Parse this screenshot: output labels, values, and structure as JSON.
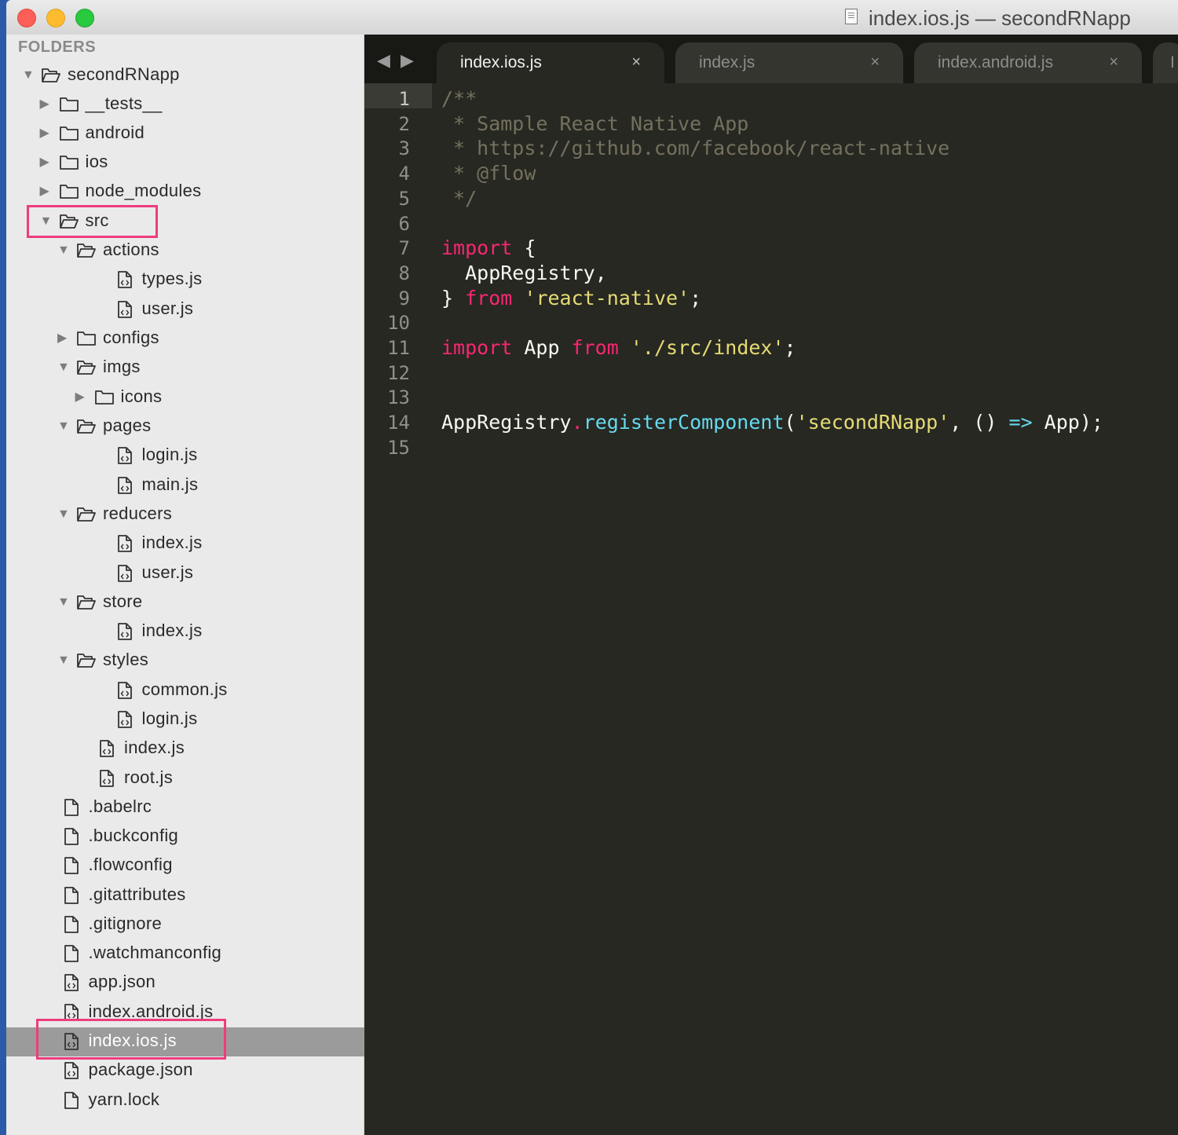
{
  "window": {
    "title": "index.ios.js — secondRNapp"
  },
  "sidebar": {
    "header": "FOLDERS",
    "tree": [
      {
        "label": "secondRNapp",
        "type": "folder",
        "open": true,
        "depth": 0
      },
      {
        "label": "__tests__",
        "type": "folder",
        "open": false,
        "depth": 1
      },
      {
        "label": "android",
        "type": "folder",
        "open": false,
        "depth": 1
      },
      {
        "label": "ios",
        "type": "folder",
        "open": false,
        "depth": 1
      },
      {
        "label": "node_modules",
        "type": "folder",
        "open": false,
        "depth": 1
      },
      {
        "label": "src",
        "type": "folder",
        "open": true,
        "depth": 1,
        "highlighted": true
      },
      {
        "label": "actions",
        "type": "folder",
        "open": true,
        "depth": 2
      },
      {
        "label": "types.js",
        "type": "js",
        "depth": 3
      },
      {
        "label": "user.js",
        "type": "js",
        "depth": 3
      },
      {
        "label": "configs",
        "type": "folder",
        "open": false,
        "depth": 2
      },
      {
        "label": "imgs",
        "type": "folder",
        "open": true,
        "depth": 2
      },
      {
        "label": "icons",
        "type": "folder",
        "open": false,
        "depth": 3
      },
      {
        "label": "pages",
        "type": "folder",
        "open": true,
        "depth": 2
      },
      {
        "label": "login.js",
        "type": "js",
        "depth": 3
      },
      {
        "label": "main.js",
        "type": "js",
        "depth": 3
      },
      {
        "label": "reducers",
        "type": "folder",
        "open": true,
        "depth": 2
      },
      {
        "label": "index.js",
        "type": "js",
        "depth": 3
      },
      {
        "label": "user.js",
        "type": "js",
        "depth": 3
      },
      {
        "label": "store",
        "type": "folder",
        "open": true,
        "depth": 2
      },
      {
        "label": "index.js",
        "type": "js",
        "depth": 3
      },
      {
        "label": "styles",
        "type": "folder",
        "open": true,
        "depth": 2
      },
      {
        "label": "common.js",
        "type": "js",
        "depth": 3
      },
      {
        "label": "login.js",
        "type": "js",
        "depth": 3
      },
      {
        "label": "index.js",
        "type": "js",
        "depth": 2
      },
      {
        "label": "root.js",
        "type": "js",
        "depth": 2
      },
      {
        "label": ".babelrc",
        "type": "file",
        "depth": 1
      },
      {
        "label": ".buckconfig",
        "type": "file",
        "depth": 1
      },
      {
        "label": ".flowconfig",
        "type": "file",
        "depth": 1
      },
      {
        "label": ".gitattributes",
        "type": "file",
        "depth": 1
      },
      {
        "label": ".gitignore",
        "type": "file",
        "depth": 1
      },
      {
        "label": ".watchmanconfig",
        "type": "file",
        "depth": 1
      },
      {
        "label": "app.json",
        "type": "js",
        "depth": 1
      },
      {
        "label": "index.android.js",
        "type": "js",
        "depth": 1
      },
      {
        "label": "index.ios.js",
        "type": "js",
        "depth": 1,
        "selected": true,
        "highlighted": true
      },
      {
        "label": "package.json",
        "type": "js",
        "depth": 1
      },
      {
        "label": "yarn.lock",
        "type": "file",
        "depth": 1
      }
    ]
  },
  "editor": {
    "tabs": [
      {
        "label": "index.ios.js",
        "active": true,
        "close": "×"
      },
      {
        "label": "index.js",
        "active": false,
        "close": "×"
      },
      {
        "label": "index.android.js",
        "active": false,
        "close": "×"
      },
      {
        "label": "I",
        "active": false,
        "close": ""
      }
    ],
    "nav": {
      "back": "◀",
      "forward": "▶"
    },
    "current_line": 1,
    "lines": [
      [
        [
          "cm",
          "/**"
        ]
      ],
      [
        [
          "cm",
          " * Sample React Native App"
        ]
      ],
      [
        [
          "cm",
          " * https://github.com/facebook/react-native"
        ]
      ],
      [
        [
          "cm",
          " * @flow"
        ]
      ],
      [
        [
          "cm",
          " */"
        ]
      ],
      [],
      [
        [
          "kw",
          "import"
        ],
        [
          "",
          " {"
        ]
      ],
      [
        [
          "",
          "  AppRegistry,"
        ]
      ],
      [
        [
          "",
          "} "
        ],
        [
          "kw",
          "from"
        ],
        [
          "",
          " "
        ],
        [
          "st",
          "'react-native'"
        ],
        [
          "",
          ";"
        ]
      ],
      [],
      [
        [
          "kw",
          "import"
        ],
        [
          "",
          " App "
        ],
        [
          "kw",
          "from"
        ],
        [
          "",
          " "
        ],
        [
          "st",
          "'./src/index'"
        ],
        [
          "",
          ";"
        ]
      ],
      [],
      [],
      [
        [
          "",
          "AppRegistry"
        ],
        [
          "kw",
          "."
        ],
        [
          "fn",
          "registerComponent"
        ],
        [
          "",
          "("
        ],
        [
          "st",
          "'secondRNapp'"
        ],
        [
          "",
          ", () "
        ],
        [
          "fn",
          "=>"
        ],
        [
          "",
          " App);"
        ]
      ],
      []
    ]
  }
}
